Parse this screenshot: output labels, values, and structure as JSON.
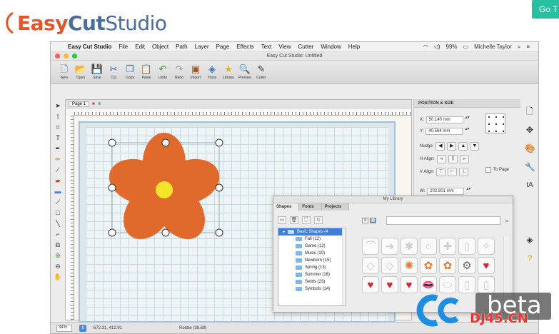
{
  "brand": {
    "easy": "Easy",
    "cut": "Cut",
    "studio": "Studio",
    "goto_label": "Go T"
  },
  "menubar": {
    "items": [
      "Easy Cut Studio",
      "File",
      "Edit",
      "Object",
      "Path",
      "Layer",
      "Page",
      "Effects",
      "Text",
      "View",
      "Cutter",
      "Window",
      "Help"
    ],
    "battery": "99%",
    "user": "Michelle Taylor"
  },
  "window": {
    "title": "Easy Cut Studio: Untitled"
  },
  "toolbar": {
    "buttons": [
      {
        "label": "New",
        "icon": "new-doc-icon"
      },
      {
        "label": "Open",
        "icon": "open-folder-icon"
      },
      {
        "label": "Save",
        "icon": "save-disk-icon"
      },
      {
        "label": "Cut",
        "icon": "scissors-icon"
      },
      {
        "label": "Copy",
        "icon": "copy-icon"
      },
      {
        "label": "Paste",
        "icon": "paste-icon"
      },
      {
        "label": "Undo",
        "icon": "undo-icon"
      },
      {
        "label": "Redo",
        "icon": "redo-icon"
      },
      {
        "label": "Import",
        "icon": "import-image-icon"
      },
      {
        "label": "Trace",
        "icon": "trace-icon"
      },
      {
        "label": "Library",
        "icon": "library-star-icon"
      },
      {
        "label": "Preview",
        "icon": "preview-magnifier-icon"
      },
      {
        "label": "Cutter",
        "icon": "cutter-blade-icon"
      }
    ]
  },
  "document": {
    "page_tab": "Page 1"
  },
  "position_size": {
    "title": "POSITION & SIZE",
    "x_label": "X:",
    "x_value": "50.140 mm",
    "y_label": "Y:",
    "y_value": "40.564 mm",
    "nudge_label": "Nudge:",
    "halign_label": "H Align:",
    "valign_label": "V Align:",
    "to_page_label": "To Page",
    "w_label": "W:",
    "w_value": "202.801 mm"
  },
  "library": {
    "title": "My Library",
    "tabs": [
      "Shapes",
      "Fonts",
      "Projects"
    ],
    "folders": [
      {
        "name": "Basic Shapes (4",
        "selected": true
      },
      {
        "name": "Fall (12)",
        "selected": false
      },
      {
        "name": "Game (12)",
        "selected": false
      },
      {
        "name": "Music (10)",
        "selected": false
      },
      {
        "name": "Newborn (15)",
        "selected": false
      },
      {
        "name": "Spring (13)",
        "selected": false
      },
      {
        "name": "Summer (16)",
        "selected": false
      },
      {
        "name": "Swirls (23)",
        "selected": false
      },
      {
        "name": "Symbols (14)",
        "selected": false
      }
    ],
    "shapes": [
      {
        "glyph": "⌒",
        "color": "#cfcfcf"
      },
      {
        "glyph": "➜",
        "color": "#cfcfcf"
      },
      {
        "glyph": "✱",
        "color": "#cfcfcf"
      },
      {
        "glyph": "○",
        "color": "#cfcfcf"
      },
      {
        "glyph": "✚",
        "color": "#cfcfcf"
      },
      {
        "glyph": "▯",
        "color": "#cfcfcf"
      },
      {
        "glyph": "✧",
        "color": "#cfcfcf"
      },
      {
        "glyph": "◇",
        "color": "#cfcfcf"
      },
      {
        "glyph": "◇",
        "color": "#cfcfcf"
      },
      {
        "glyph": "✺",
        "color": "#e8762e"
      },
      {
        "glyph": "✿",
        "color": "#e8762e"
      },
      {
        "glyph": "✿",
        "color": "#e8762e"
      },
      {
        "glyph": "⚙",
        "color": "#6a6a6a"
      },
      {
        "glyph": "♥",
        "color": "#d8262e"
      },
      {
        "glyph": "♥",
        "color": "#d8262e"
      },
      {
        "glyph": "♥",
        "color": "#d8262e"
      },
      {
        "glyph": "♥",
        "color": "#d8262e"
      },
      {
        "glyph": "👄",
        "color": "#d8262e"
      },
      {
        "glyph": "⬭",
        "color": "#cfcfcf"
      },
      {
        "glyph": "▯",
        "color": "#cfcfcf"
      },
      {
        "glyph": "▯",
        "color": "#cfcfcf"
      }
    ]
  },
  "statusbar": {
    "zoom": "34%",
    "coords": "672.31, 412.91",
    "rotate": "Rotate (38.69)"
  },
  "watermark": {
    "brand": "beta",
    "site": "DJ45.CN"
  },
  "colors": {
    "flower_petal": "#e06a2c",
    "flower_center": "#f5e52a",
    "accent_green": "#27c0a3",
    "brand_orange": "#e2552b",
    "brand_blue": "#4a6c9b",
    "selection_blue": "#3d7fd9"
  }
}
